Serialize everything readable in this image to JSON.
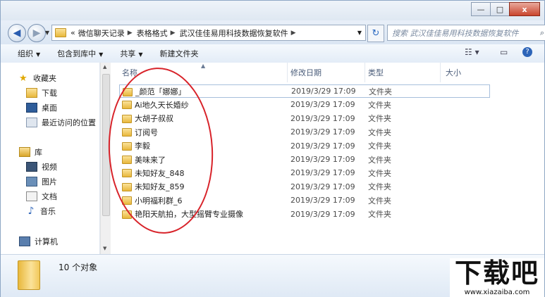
{
  "window": {
    "minimize": "—",
    "maximize": "□",
    "close": "x"
  },
  "address": {
    "overflow": "«",
    "crumbs": [
      "微信聊天记录",
      "表格格式",
      "武汉佳佳易用科技数据恢复软件"
    ],
    "search_placeholder": "搜索 武汉佳佳易用科技数据恢复软件"
  },
  "toolbar": {
    "organize": "组织",
    "include_in_library": "包含到库中",
    "share": "共享",
    "new_folder": "新建文件夹"
  },
  "sidebar": {
    "favorites": "收藏夹",
    "downloads": "下载",
    "desktop": "桌面",
    "recent": "最近访问的位置",
    "libraries": "库",
    "videos": "视频",
    "pictures": "图片",
    "documents": "文档",
    "music": "音乐",
    "computer": "计算机"
  },
  "columns": {
    "name": "名称",
    "modified": "修改日期",
    "type": "类型",
    "size": "大小"
  },
  "files": [
    {
      "name": "_颜范「娜娜」",
      "date": "2019/3/29 17:09",
      "type": "文件夹"
    },
    {
      "name": "Ai地久天长婚纱",
      "date": "2019/3/29 17:09",
      "type": "文件夹"
    },
    {
      "name": "大胡子叔叔",
      "date": "2019/3/29 17:09",
      "type": "文件夹"
    },
    {
      "name": "订阅号",
      "date": "2019/3/29 17:09",
      "type": "文件夹"
    },
    {
      "name": "李毅",
      "date": "2019/3/29 17:09",
      "type": "文件夹"
    },
    {
      "name": "美味来了",
      "date": "2019/3/29 17:09",
      "type": "文件夹"
    },
    {
      "name": "未知好友_848",
      "date": "2019/3/29 17:09",
      "type": "文件夹"
    },
    {
      "name": "未知好友_859",
      "date": "2019/3/29 17:09",
      "type": "文件夹"
    },
    {
      "name": "小明福利群_6",
      "date": "2019/3/29 17:09",
      "type": "文件夹"
    },
    {
      "name": "艳阳天航拍，大型摇臂专业摄像",
      "date": "2019/3/29 17:09",
      "type": "文件夹"
    }
  ],
  "status": {
    "item_count": "10 个对象"
  },
  "watermark": {
    "logo_text": "下载吧",
    "url": "www.xiazaiba.com"
  },
  "colors": {
    "annotation_circle": "#d8232a",
    "folder": "#e8b83c"
  }
}
